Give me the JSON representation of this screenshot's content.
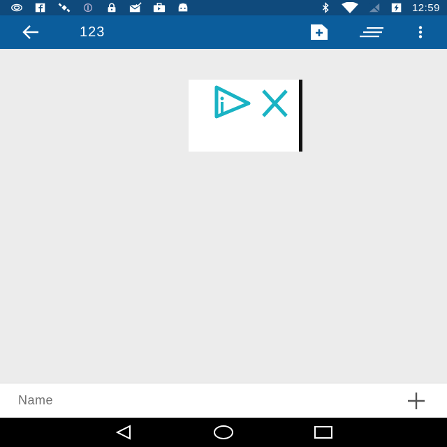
{
  "status_bar": {
    "time": "12:59",
    "icons_left": [
      "radio-waves-icon",
      "facebook-icon",
      "satellite-icon",
      "nfc-icon",
      "lock-icon",
      "mail-check-icon",
      "briefcase-icon",
      "android-icon"
    ],
    "icons_right": [
      "bluetooth-icon",
      "wifi-icon",
      "no-signal-icon",
      "battery-charging-icon"
    ]
  },
  "app_bar": {
    "title": "123",
    "background": "#0b5d9c",
    "actions": [
      "add-document-icon",
      "sort-icon",
      "more-vert-icon"
    ]
  },
  "content": {
    "image_colors": {
      "icon": "#1ab3c4",
      "border": "#111111"
    }
  },
  "bottom_bar": {
    "name_placeholder": "Name",
    "add_icon": "plus-icon"
  },
  "nav_bar": {
    "buttons": [
      "back-triangle-icon",
      "home-circle-icon",
      "recents-square-icon"
    ]
  }
}
